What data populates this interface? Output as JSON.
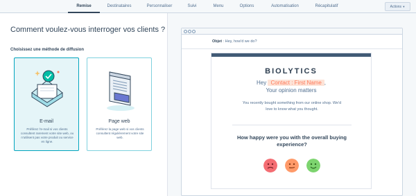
{
  "nav": {
    "tabs": [
      {
        "label": "Remise"
      },
      {
        "label": "Destinataires"
      },
      {
        "label": "Personnaliser"
      },
      {
        "label": "Suivi"
      },
      {
        "label": "Menu"
      },
      {
        "label": "Options"
      },
      {
        "label": "Automatisation"
      },
      {
        "label": "Récapitulatif"
      }
    ],
    "active_tab": "Remise",
    "actions_label": "Actions"
  },
  "left": {
    "heading": "Comment voulez-vous interroger vos clients ?",
    "subheading": "Choisissez une méthode de diffusion",
    "options": [
      {
        "title": "E-mail",
        "description": "Préférez l'e-mail si vos clients consultent rarement votre site web, ou n'utilisent pas votre produit ou service en ligne.",
        "icon": "email-icon",
        "selected": true
      },
      {
        "title": "Page web",
        "description": "Préférez la page web si vos clients consultent régulièrement votre site web.",
        "icon": "web-page-icon",
        "selected": false
      }
    ]
  },
  "preview": {
    "subject_label": "Objet",
    "subject_value": "Hey, how'd we do?",
    "email": {
      "logo": "BIOLYTICS",
      "hey": "Hey",
      "token": "Contact : First Name",
      "comma": ",",
      "opinion": "Your opinion matters",
      "body": "You recently bought something from our online shop. We'd love to know what you thought.",
      "question": "How happy were you with the overall buying experience?",
      "faces": [
        "sad-face-icon",
        "neutral-face-icon",
        "happy-face-icon"
      ]
    }
  },
  "colors": {
    "accent": "#00a4bd",
    "token_bg": "#fde3d7",
    "token_text": "#ff7a59",
    "sad": "#f2545b",
    "neutral": "#ff8f59",
    "happy": "#6fcf5f"
  }
}
